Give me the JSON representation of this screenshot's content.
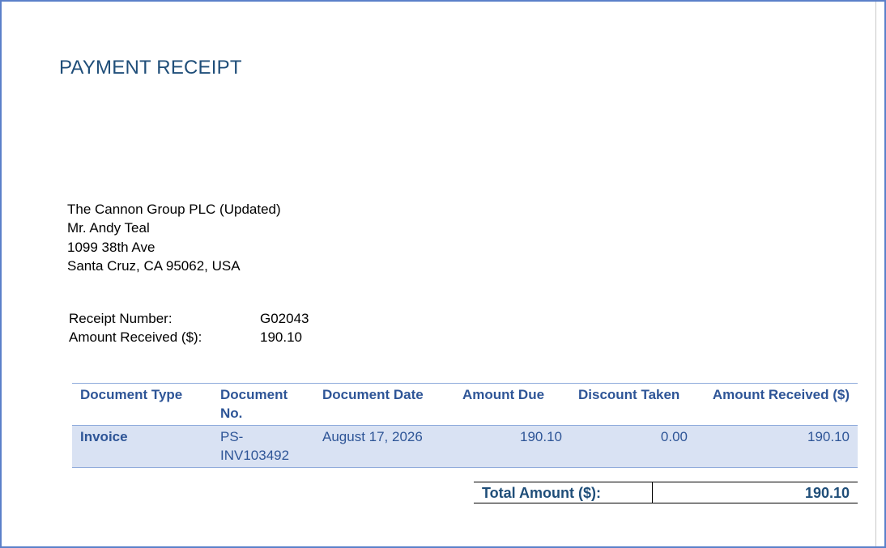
{
  "title": "PAYMENT RECEIPT",
  "address": {
    "company": "The Cannon Group PLC (Updated)",
    "contact": "Mr. Andy Teal",
    "street": "1099 38th Ave",
    "city": "Santa Cruz, CA 95062, USA"
  },
  "receipt": {
    "number_label": "Receipt Number:",
    "number_value": "G02043",
    "amount_label": "Amount Received ($):",
    "amount_value": "190.10"
  },
  "table": {
    "headers": [
      "Document Type",
      "Document No.",
      "Document Date",
      "Amount Due",
      "Discount Taken",
      "Amount Received ($)"
    ],
    "rows": [
      [
        "Invoice",
        "PS-INV103492",
        "August 17, 2026",
        "190.10",
        "0.00",
        "190.10"
      ]
    ]
  },
  "total": {
    "label": "Total Amount ($):",
    "value": "190.10"
  },
  "colors": {
    "title": "#1f4e79",
    "table_text": "#2e5597",
    "row_fill": "#d9e2f3",
    "frame": "#5b80c9"
  }
}
